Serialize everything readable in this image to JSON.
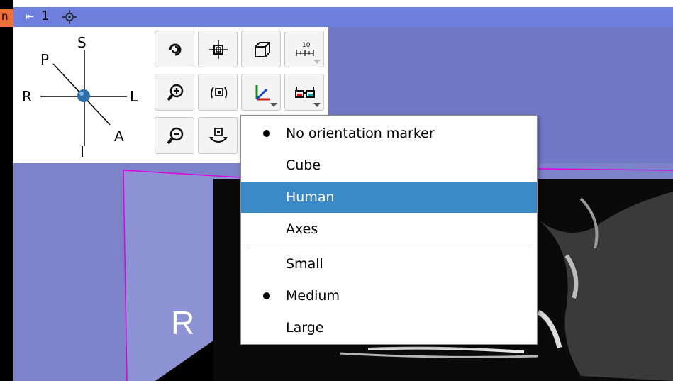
{
  "left_tab": {
    "label": "n"
  },
  "view_header": {
    "pin_glyph": "⇤",
    "view_number": "1"
  },
  "orientation_widget": {
    "labels": {
      "S": "S",
      "P": "P",
      "R": "R",
      "L": "L",
      "A": "A",
      "I": "I"
    }
  },
  "toolbar": {
    "buttons": [
      {
        "name": "spin-button",
        "icon": "spin-icon"
      },
      {
        "name": "center-view-button",
        "icon": "crosshair-icon"
      },
      {
        "name": "projection-button",
        "icon": "cube-outline-icon"
      },
      {
        "name": "ruler-button",
        "icon": "ruler-icon",
        "ruler_text": "10",
        "has_menu": true
      },
      {
        "name": "zoom-in-button",
        "icon": "zoom-in-icon"
      },
      {
        "name": "rock-button",
        "icon": "rock-icon"
      },
      {
        "name": "orientation-marker-button",
        "icon": "axes-icon",
        "has_menu": true
      },
      {
        "name": "stereo-button",
        "icon": "stereo-glasses-icon",
        "has_menu": true
      },
      {
        "name": "zoom-out-button",
        "icon": "zoom-out-icon"
      },
      {
        "name": "pitch-button",
        "icon": "pitch-icon"
      }
    ]
  },
  "view3d": {
    "side_label": "R"
  },
  "menu": {
    "items": [
      {
        "label": "No orientation marker",
        "checked": true,
        "highlighted": false
      },
      {
        "label": "Cube",
        "checked": false,
        "highlighted": false
      },
      {
        "label": "Human",
        "checked": false,
        "highlighted": true
      },
      {
        "label": "Axes",
        "checked": false,
        "highlighted": false
      }
    ],
    "size_items": [
      {
        "label": "Small",
        "checked": false
      },
      {
        "label": "Medium",
        "checked": true
      },
      {
        "label": "Large",
        "checked": false
      }
    ]
  },
  "colors": {
    "title_bar": "#6f80dc",
    "view_background": "#7d83c9",
    "menu_highlight": "#3a8ac8",
    "slice_outline": "#e000e0",
    "orange_tab": "#f0703a"
  }
}
